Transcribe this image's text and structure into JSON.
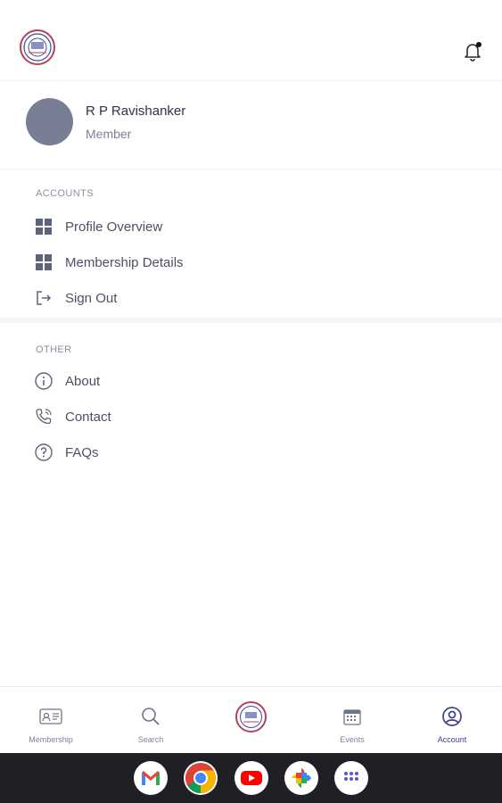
{
  "profile": {
    "name": "R P Ravishanker",
    "role": "Member"
  },
  "accounts": {
    "title": "ACCOUNTS",
    "items": [
      {
        "label": "Profile Overview",
        "icon": "grid-icon"
      },
      {
        "label": "Membership Details",
        "icon": "grid-icon"
      },
      {
        "label": "Sign Out",
        "icon": "sign-out-icon"
      }
    ]
  },
  "other": {
    "title": "OTHER",
    "items": [
      {
        "label": "About",
        "icon": "info-icon"
      },
      {
        "label": "Contact",
        "icon": "phone-icon"
      },
      {
        "label": "FAQs",
        "icon": "help-icon"
      }
    ]
  },
  "bottom_nav": [
    {
      "label": "Membership",
      "icon": "membership-card-icon"
    },
    {
      "label": "Search",
      "icon": "search-icon"
    },
    {
      "label": "",
      "icon": "home-logo-icon"
    },
    {
      "label": "Events",
      "icon": "calendar-icon"
    },
    {
      "label": "Account",
      "icon": "account-icon",
      "active": true
    }
  ],
  "system_apps": [
    "gmail-icon",
    "chrome-icon",
    "youtube-icon",
    "photos-icon",
    "app-drawer-icon"
  ],
  "colors": {
    "accent": "#3a3f8f",
    "avatar": "#787f94",
    "logo_ring": "#b8415a",
    "system_bar": "#1f2025"
  }
}
